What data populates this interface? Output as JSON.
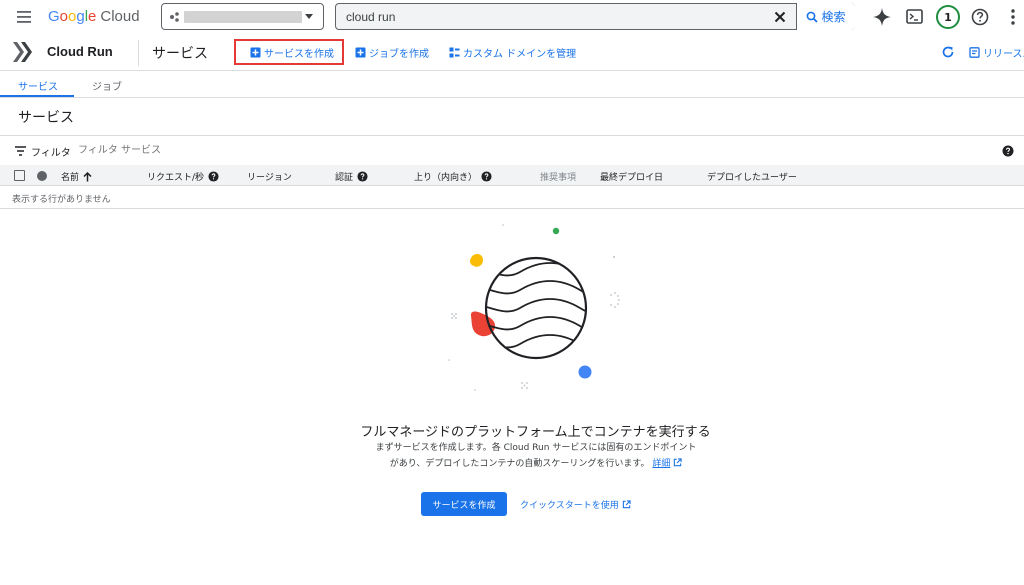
{
  "topbar": {
    "logo_g": [
      "G",
      "o",
      "o",
      "g",
      "l",
      "e"
    ],
    "logo_cloud": "Cloud",
    "search_value": "cloud run",
    "search_button": "検索",
    "notification_count": "1"
  },
  "toolbar": {
    "product_title": "Cloud Run",
    "page_title": "サービス",
    "create_service": "サービスを作成",
    "create_job": "ジョブを作成",
    "manage_domains": "カスタム ドメインを管理",
    "release_notes": "リリース..."
  },
  "tabs": [
    {
      "label": "サービス",
      "active": true
    },
    {
      "label": "ジョブ",
      "active": false
    }
  ],
  "section_title": "サービス",
  "filter": {
    "label": "フィルタ",
    "placeholder": "フィルタ サービス"
  },
  "table": {
    "columns": [
      "名前",
      "リクエスト/秒",
      "リージョン",
      "認証",
      "上り（内向き）",
      "推奨事項",
      "最終デプロイ日",
      "デプロイしたユーザー"
    ],
    "empty_message": "表示する行がありません"
  },
  "empty_state": {
    "title": "フルマネージドのプラットフォーム上でコンテナを実行する",
    "desc_line1": "まずサービスを作成します。各 Cloud Run サービスには固有のエンドポイント",
    "desc_line2": "があり、デプロイしたコンテナの自動スケーリングを行います。",
    "details_link": "詳細",
    "primary_button": "サービスを作成",
    "secondary_link": "クイックスタートを使用"
  },
  "colors": {
    "accent": "#1a73e8",
    "highlight_box": "#e53935",
    "status_ring": "#1e8e3e"
  }
}
